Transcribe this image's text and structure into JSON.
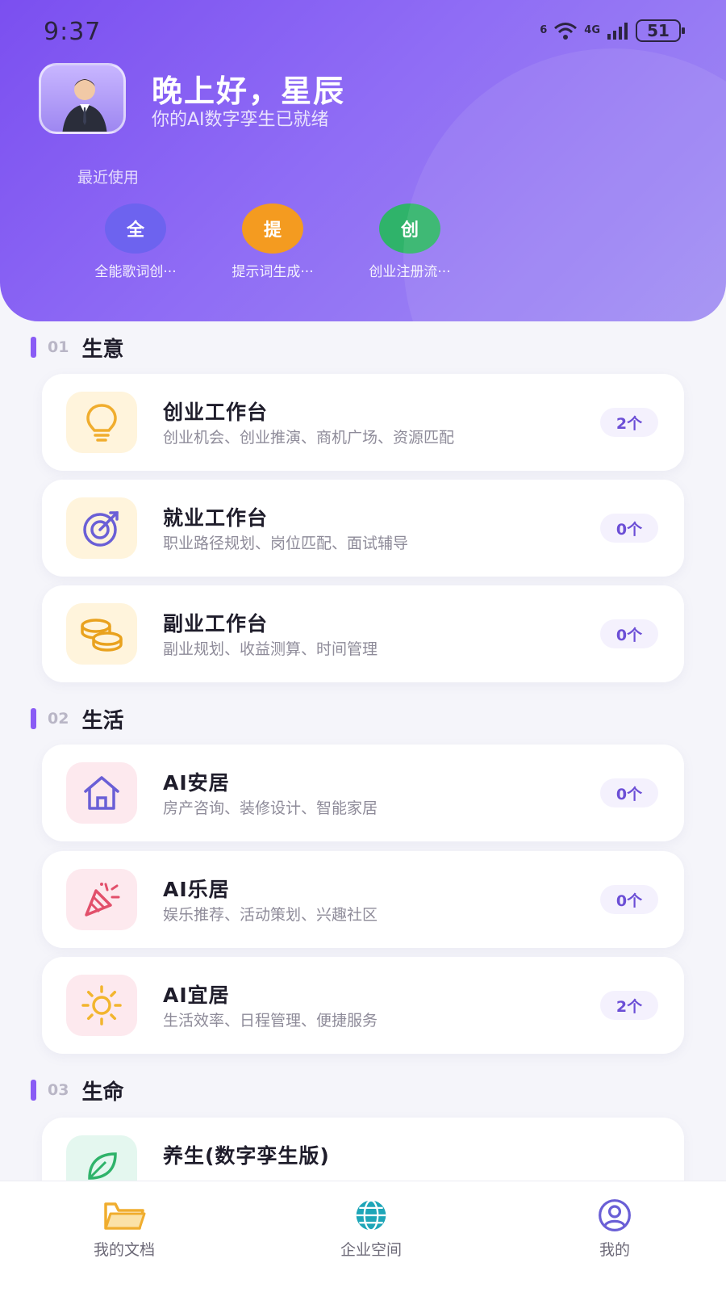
{
  "status_bar": {
    "time": "9:37",
    "network": "4G",
    "signal_label": "6",
    "battery": "51"
  },
  "header": {
    "greeting": "晚上好，星辰",
    "subtitle": "你的AI数字孪生已就绪",
    "recent_title": "最近使用",
    "recent": [
      {
        "glyph": "全",
        "label": "全能歌词创···",
        "color": "#6d63ef"
      },
      {
        "glyph": "提",
        "label": "提示词生成···",
        "color": "#f49b20"
      },
      {
        "glyph": "创",
        "label": "创业注册流···",
        "color": "#2fb36a"
      }
    ]
  },
  "sections": [
    {
      "num": "01",
      "title": "生意",
      "cards": [
        {
          "title": "创业工作台",
          "desc": "创业机会、创业推演、商机广场、资源匹配",
          "badge": "2个",
          "icon": "lightbulb-icon",
          "icon_bg": "#fff4dc",
          "icon_color": "#f0ad2e"
        },
        {
          "title": "就业工作台",
          "desc": "职业路径规划、岗位匹配、面试辅导",
          "badge": "0个",
          "icon": "target-icon",
          "icon_bg": "#fff4dc",
          "icon_color": "#6a5fd6"
        },
        {
          "title": "副业工作台",
          "desc": "副业规划、收益测算、时间管理",
          "badge": "0个",
          "icon": "coins-icon",
          "icon_bg": "#fff4dc",
          "icon_color": "#e9a21e"
        }
      ]
    },
    {
      "num": "02",
      "title": "生活",
      "cards": [
        {
          "title": "AI安居",
          "desc": "房产咨询、装修设计、智能家居",
          "badge": "0个",
          "icon": "home-icon",
          "icon_bg": "#fde9ee",
          "icon_color": "#6a5fd6"
        },
        {
          "title": "AI乐居",
          "desc": "娱乐推荐、活动策划、兴趣社区",
          "badge": "0个",
          "icon": "party-popper-icon",
          "icon_bg": "#fde9ee",
          "icon_color": "#e2506b"
        },
        {
          "title": "AI宜居",
          "desc": "生活效率、日程管理、便捷服务",
          "badge": "2个",
          "icon": "sun-icon",
          "icon_bg": "#fde9ee",
          "icon_color": "#f2b52e"
        }
      ]
    },
    {
      "num": "03",
      "title": "生命",
      "cards": [
        {
          "title": "养生(数字孪生版)",
          "desc": "",
          "badge": "",
          "icon": "leaf-icon",
          "icon_bg": "#e4f7ef",
          "icon_color": "#2fb36a"
        }
      ]
    }
  ],
  "bottom_nav": [
    {
      "label": "我的文档",
      "icon": "folder-icon",
      "color": "#f0ad2e"
    },
    {
      "label": "企业空间",
      "icon": "globe-icon",
      "color": "#1ea6b8"
    },
    {
      "label": "我的",
      "icon": "user-circle-icon",
      "color": "#6a5fd6"
    }
  ]
}
